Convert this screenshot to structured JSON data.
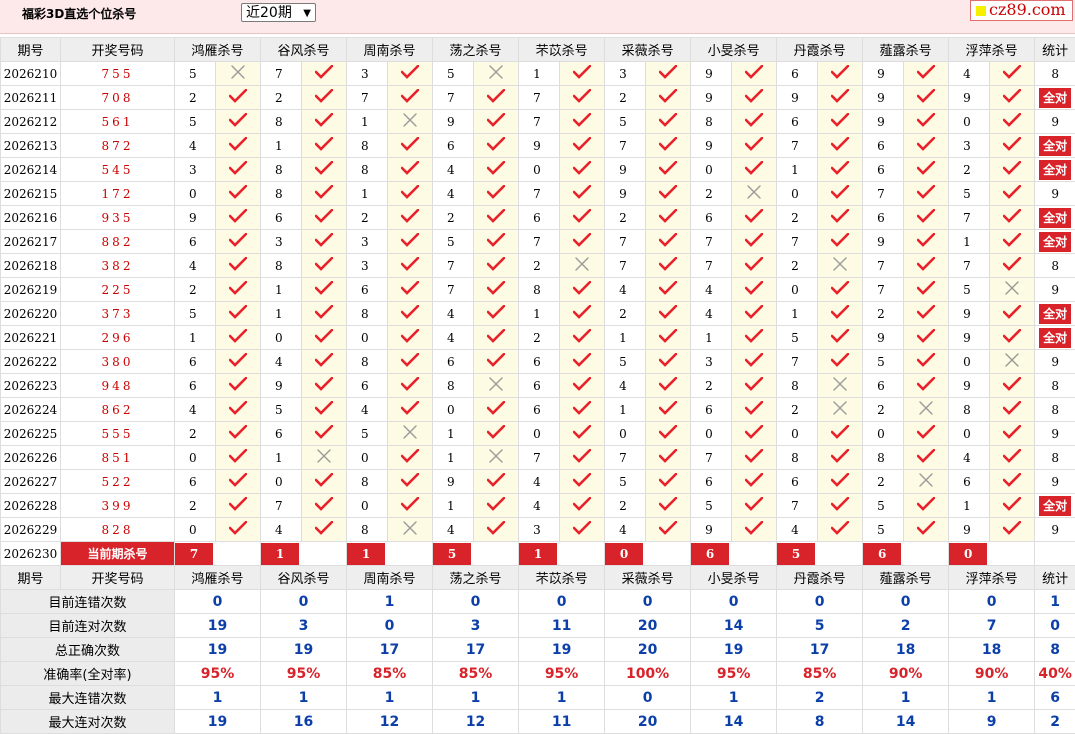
{
  "header": {
    "title": "福彩3D直选个位杀号",
    "period_select": "近20期",
    "logo_text": "cz89.com"
  },
  "columns": {
    "issue": "期号",
    "draw": "开奖号码",
    "experts": [
      "鸿雁杀号",
      "谷风杀号",
      "周南杀号",
      "荡之杀号",
      "芣苡杀号",
      "采薇杀号",
      "小旻杀号",
      "丹霞杀号",
      "薤露杀号",
      "浮萍杀号"
    ],
    "stat": "统计"
  },
  "rows": [
    {
      "issue": "2026210",
      "draw": "755",
      "cells": [
        [
          "5",
          false
        ],
        [
          "7",
          true
        ],
        [
          "3",
          true
        ],
        [
          "5",
          false
        ],
        [
          "1",
          true
        ],
        [
          "3",
          true
        ],
        [
          "9",
          true
        ],
        [
          "6",
          true
        ],
        [
          "9",
          true
        ],
        [
          "4",
          true
        ]
      ],
      "stat": "8"
    },
    {
      "issue": "2026211",
      "draw": "708",
      "cells": [
        [
          "2",
          true
        ],
        [
          "2",
          true
        ],
        [
          "7",
          true
        ],
        [
          "7",
          true
        ],
        [
          "7",
          true
        ],
        [
          "2",
          true
        ],
        [
          "9",
          true
        ],
        [
          "9",
          true
        ],
        [
          "9",
          true
        ],
        [
          "9",
          true
        ]
      ],
      "stat": "全对"
    },
    {
      "issue": "2026212",
      "draw": "561",
      "cells": [
        [
          "5",
          true
        ],
        [
          "8",
          true
        ],
        [
          "1",
          false
        ],
        [
          "9",
          true
        ],
        [
          "7",
          true
        ],
        [
          "5",
          true
        ],
        [
          "8",
          true
        ],
        [
          "6",
          true
        ],
        [
          "9",
          true
        ],
        [
          "0",
          true
        ]
      ],
      "stat": "9"
    },
    {
      "issue": "2026213",
      "draw": "872",
      "cells": [
        [
          "4",
          true
        ],
        [
          "1",
          true
        ],
        [
          "8",
          true
        ],
        [
          "6",
          true
        ],
        [
          "9",
          true
        ],
        [
          "7",
          true
        ],
        [
          "9",
          true
        ],
        [
          "7",
          true
        ],
        [
          "6",
          true
        ],
        [
          "3",
          true
        ]
      ],
      "stat": "全对"
    },
    {
      "issue": "2026214",
      "draw": "545",
      "cells": [
        [
          "3",
          true
        ],
        [
          "8",
          true
        ],
        [
          "8",
          true
        ],
        [
          "4",
          true
        ],
        [
          "0",
          true
        ],
        [
          "9",
          true
        ],
        [
          "0",
          true
        ],
        [
          "1",
          true
        ],
        [
          "6",
          true
        ],
        [
          "2",
          true
        ]
      ],
      "stat": "全对"
    },
    {
      "issue": "2026215",
      "draw": "172",
      "cells": [
        [
          "0",
          true
        ],
        [
          "8",
          true
        ],
        [
          "1",
          true
        ],
        [
          "4",
          true
        ],
        [
          "7",
          true
        ],
        [
          "9",
          true
        ],
        [
          "2",
          false
        ],
        [
          "0",
          true
        ],
        [
          "7",
          true
        ],
        [
          "5",
          true
        ]
      ],
      "stat": "9"
    },
    {
      "issue": "2026216",
      "draw": "935",
      "cells": [
        [
          "9",
          true
        ],
        [
          "6",
          true
        ],
        [
          "2",
          true
        ],
        [
          "2",
          true
        ],
        [
          "6",
          true
        ],
        [
          "2",
          true
        ],
        [
          "6",
          true
        ],
        [
          "2",
          true
        ],
        [
          "6",
          true
        ],
        [
          "7",
          true
        ]
      ],
      "stat": "全对"
    },
    {
      "issue": "2026217",
      "draw": "882",
      "cells": [
        [
          "6",
          true
        ],
        [
          "3",
          true
        ],
        [
          "3",
          true
        ],
        [
          "5",
          true
        ],
        [
          "7",
          true
        ],
        [
          "7",
          true
        ],
        [
          "7",
          true
        ],
        [
          "7",
          true
        ],
        [
          "9",
          true
        ],
        [
          "1",
          true
        ]
      ],
      "stat": "全对"
    },
    {
      "issue": "2026218",
      "draw": "382",
      "cells": [
        [
          "4",
          true
        ],
        [
          "8",
          true
        ],
        [
          "3",
          true
        ],
        [
          "7",
          true
        ],
        [
          "2",
          false
        ],
        [
          "7",
          true
        ],
        [
          "7",
          true
        ],
        [
          "2",
          false
        ],
        [
          "7",
          true
        ],
        [
          "7",
          true
        ]
      ],
      "stat": "8"
    },
    {
      "issue": "2026219",
      "draw": "225",
      "cells": [
        [
          "2",
          true
        ],
        [
          "1",
          true
        ],
        [
          "6",
          true
        ],
        [
          "7",
          true
        ],
        [
          "8",
          true
        ],
        [
          "4",
          true
        ],
        [
          "4",
          true
        ],
        [
          "0",
          true
        ],
        [
          "7",
          true
        ],
        [
          "5",
          false
        ]
      ],
      "stat": "9"
    },
    {
      "issue": "2026220",
      "draw": "373",
      "cells": [
        [
          "5",
          true
        ],
        [
          "1",
          true
        ],
        [
          "8",
          true
        ],
        [
          "4",
          true
        ],
        [
          "1",
          true
        ],
        [
          "2",
          true
        ],
        [
          "4",
          true
        ],
        [
          "1",
          true
        ],
        [
          "2",
          true
        ],
        [
          "9",
          true
        ]
      ],
      "stat": "全对"
    },
    {
      "issue": "2026221",
      "draw": "296",
      "cells": [
        [
          "1",
          true
        ],
        [
          "0",
          true
        ],
        [
          "0",
          true
        ],
        [
          "4",
          true
        ],
        [
          "2",
          true
        ],
        [
          "1",
          true
        ],
        [
          "1",
          true
        ],
        [
          "5",
          true
        ],
        [
          "9",
          true
        ],
        [
          "9",
          true
        ]
      ],
      "stat": "全对"
    },
    {
      "issue": "2026222",
      "draw": "380",
      "cells": [
        [
          "6",
          true
        ],
        [
          "4",
          true
        ],
        [
          "8",
          true
        ],
        [
          "6",
          true
        ],
        [
          "6",
          true
        ],
        [
          "5",
          true
        ],
        [
          "3",
          true
        ],
        [
          "7",
          true
        ],
        [
          "5",
          true
        ],
        [
          "0",
          false
        ]
      ],
      "stat": "9"
    },
    {
      "issue": "2026223",
      "draw": "948",
      "cells": [
        [
          "6",
          true
        ],
        [
          "9",
          true
        ],
        [
          "6",
          true
        ],
        [
          "8",
          false
        ],
        [
          "6",
          true
        ],
        [
          "4",
          true
        ],
        [
          "2",
          true
        ],
        [
          "8",
          false
        ],
        [
          "6",
          true
        ],
        [
          "9",
          true
        ]
      ],
      "stat": "8"
    },
    {
      "issue": "2026224",
      "draw": "862",
      "cells": [
        [
          "4",
          true
        ],
        [
          "5",
          true
        ],
        [
          "4",
          true
        ],
        [
          "0",
          true
        ],
        [
          "6",
          true
        ],
        [
          "1",
          true
        ],
        [
          "6",
          true
        ],
        [
          "2",
          false
        ],
        [
          "2",
          false
        ],
        [
          "8",
          true
        ]
      ],
      "stat": "8"
    },
    {
      "issue": "2026225",
      "draw": "555",
      "cells": [
        [
          "2",
          true
        ],
        [
          "6",
          true
        ],
        [
          "5",
          false
        ],
        [
          "1",
          true
        ],
        [
          "0",
          true
        ],
        [
          "0",
          true
        ],
        [
          "0",
          true
        ],
        [
          "0",
          true
        ],
        [
          "0",
          true
        ],
        [
          "0",
          true
        ]
      ],
      "stat": "9"
    },
    {
      "issue": "2026226",
      "draw": "851",
      "cells": [
        [
          "0",
          true
        ],
        [
          "1",
          false
        ],
        [
          "0",
          true
        ],
        [
          "1",
          false
        ],
        [
          "7",
          true
        ],
        [
          "7",
          true
        ],
        [
          "7",
          true
        ],
        [
          "8",
          true
        ],
        [
          "8",
          true
        ],
        [
          "4",
          true
        ]
      ],
      "stat": "8"
    },
    {
      "issue": "2026227",
      "draw": "522",
      "cells": [
        [
          "6",
          true
        ],
        [
          "0",
          true
        ],
        [
          "8",
          true
        ],
        [
          "9",
          true
        ],
        [
          "4",
          true
        ],
        [
          "5",
          true
        ],
        [
          "6",
          true
        ],
        [
          "6",
          true
        ],
        [
          "2",
          false
        ],
        [
          "6",
          true
        ]
      ],
      "stat": "9"
    },
    {
      "issue": "2026228",
      "draw": "399",
      "cells": [
        [
          "2",
          true
        ],
        [
          "7",
          true
        ],
        [
          "0",
          true
        ],
        [
          "1",
          true
        ],
        [
          "4",
          true
        ],
        [
          "2",
          true
        ],
        [
          "5",
          true
        ],
        [
          "7",
          true
        ],
        [
          "5",
          true
        ],
        [
          "1",
          true
        ]
      ],
      "stat": "全对"
    },
    {
      "issue": "2026229",
      "draw": "828",
      "cells": [
        [
          "0",
          true
        ],
        [
          "4",
          true
        ],
        [
          "8",
          false
        ],
        [
          "4",
          true
        ],
        [
          "3",
          true
        ],
        [
          "4",
          true
        ],
        [
          "9",
          true
        ],
        [
          "4",
          true
        ],
        [
          "5",
          true
        ],
        [
          "9",
          true
        ]
      ],
      "stat": "9"
    }
  ],
  "current": {
    "issue": "2026230",
    "label": "当前期杀号",
    "values": [
      "7",
      "1",
      "1",
      "5",
      "1",
      "0",
      "6",
      "5",
      "6",
      "0"
    ]
  },
  "stats": [
    {
      "label": "目前连错次数",
      "values": [
        "0",
        "0",
        "1",
        "0",
        "0",
        "0",
        "0",
        "0",
        "0",
        "0",
        "1"
      ],
      "color": "blue"
    },
    {
      "label": "目前连对次数",
      "values": [
        "19",
        "3",
        "0",
        "3",
        "11",
        "20",
        "14",
        "5",
        "2",
        "7",
        "0"
      ],
      "color": "blue"
    },
    {
      "label": "总正确次数",
      "values": [
        "19",
        "19",
        "17",
        "17",
        "19",
        "20",
        "19",
        "17",
        "18",
        "18",
        "8"
      ],
      "color": "blue"
    },
    {
      "label": "准确率(全对率)",
      "values": [
        "95%",
        "95%",
        "85%",
        "85%",
        "95%",
        "100%",
        "95%",
        "85%",
        "90%",
        "90%",
        "40%"
      ],
      "color": "red"
    },
    {
      "label": "最大连错次数",
      "values": [
        "1",
        "1",
        "1",
        "1",
        "1",
        "0",
        "1",
        "2",
        "1",
        "1",
        "6"
      ],
      "color": "blue"
    },
    {
      "label": "最大连对次数",
      "values": [
        "19",
        "16",
        "12",
        "12",
        "11",
        "20",
        "14",
        "8",
        "14",
        "9",
        "2"
      ],
      "color": "blue"
    }
  ],
  "colors": {
    "accent_red": "#d8232a",
    "check": "#e8212a",
    "cross": "#9a9a9a",
    "stat_blue": "#0c3fa8"
  }
}
